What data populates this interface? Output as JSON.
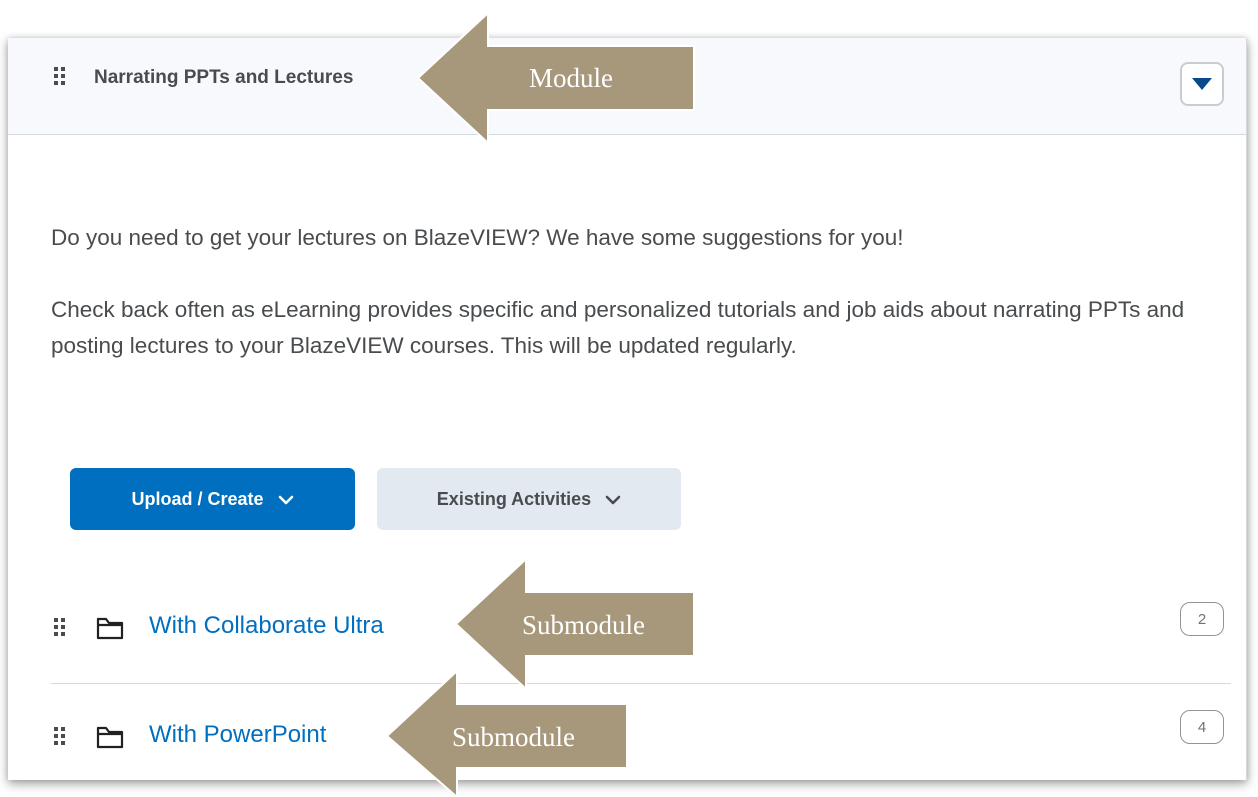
{
  "module": {
    "title": "Narrating PPTs and Lectures",
    "collapse_icon": "caret-down-icon"
  },
  "description": {
    "paragraph_1": "Do you need to get your lectures on BlazeVIEW? We have some suggestions for you!",
    "paragraph_2": "Check back often as eLearning provides specific and personalized tutorials and job aids about narrating PPTs and posting lectures to your BlazeVIEW courses. This will be updated regularly."
  },
  "actions": {
    "upload_create_label": "Upload / Create",
    "existing_activities_label": "Existing Activities"
  },
  "submodules": [
    {
      "title": "With Collaborate Ultra",
      "count": "2"
    },
    {
      "title": "With PowerPoint",
      "count": "4"
    }
  ],
  "annotations": {
    "module_label": "Module",
    "submodule_label_1": "Submodule",
    "submodule_label_2": "Submodule"
  },
  "colors": {
    "accent_blue": "#006fbf",
    "header_bg": "#f7f9fc",
    "secondary_btn_bg": "#e3e9f1",
    "text_gray": "#494c4e",
    "callout_fill": "#a8987b"
  }
}
